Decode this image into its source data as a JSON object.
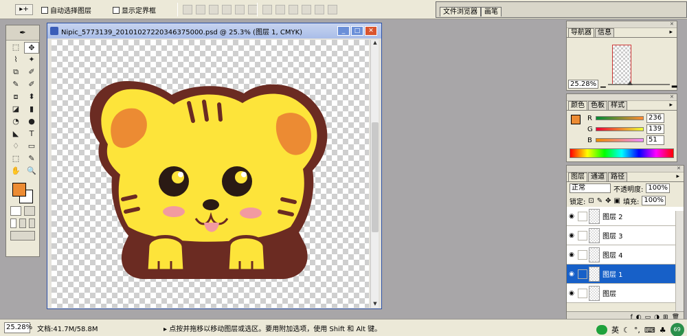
{
  "options_bar": {
    "tool_label": "▸+",
    "auto_select_label": "自动选择图层",
    "show_bounds_label": "显示定界框",
    "tabs": [
      "文件浏览器",
      "画笔"
    ]
  },
  "toolbox": {
    "header": "✒",
    "tools": [
      "⬚",
      "✥",
      "⌇",
      "✦",
      "⧉",
      "✐",
      "✎",
      "✐",
      "⧈",
      "⬍",
      "◪",
      "▮",
      "◔",
      "●",
      "◣",
      "T",
      "♢",
      "▭",
      "⬚",
      "✎",
      "✋",
      "🔍"
    ],
    "colors": {
      "foreground": "#ec8b33",
      "background": "#ffffff"
    }
  },
  "document": {
    "title": "Nipic_5773139_20101027220346375000.psd @ 25.3% (图层 1, CMYK)",
    "buttons": [
      "_",
      "□",
      "✕"
    ]
  },
  "statusbar": {
    "zoom": "25.28%",
    "doc_size": "文档:41.7M/58.8M",
    "hint": "▸ 点按并拖移以移动图层或选区。要用附加选项，使用 Shift 和 Alt 键。",
    "ime_label": "英",
    "badge": "69"
  },
  "navigator": {
    "tabs": [
      "导航器",
      "信息"
    ],
    "zoom": "25.28%"
  },
  "color_panel": {
    "tabs": [
      "颜色",
      "色板",
      "样式"
    ],
    "swatch": "#ec8b33",
    "channels": [
      {
        "label": "R",
        "value": "236",
        "gradient": "linear-gradient(90deg,#008b33,#ff8b33)"
      },
      {
        "label": "G",
        "value": "139",
        "gradient": "linear-gradient(90deg,#ec0033,#ecff33)"
      },
      {
        "label": "B",
        "value": "51",
        "gradient": "linear-gradient(90deg,#ec8b00,#ec8bff)"
      }
    ]
  },
  "layers_panel": {
    "tabs": [
      "图层",
      "通道",
      "路径"
    ],
    "blend_mode": "正常",
    "opacity_label": "不透明度:",
    "opacity": "100%",
    "lock_label": "锁定:",
    "fill_label": "填充:",
    "fill": "100%",
    "layers": [
      {
        "name": "图层 2",
        "selected": false
      },
      {
        "name": "图层 3",
        "selected": false
      },
      {
        "name": "图层 4",
        "selected": false
      },
      {
        "name": "图层 1",
        "selected": true
      },
      {
        "name": "图层",
        "selected": false
      }
    ]
  },
  "colors": {
    "tiger_yellow": "#fde43a",
    "tiger_outline": "#6b2b22",
    "ear_orange": "#ec8b33",
    "paw_shadow": "#f2b43a",
    "selection_blue": "#1760c8"
  }
}
